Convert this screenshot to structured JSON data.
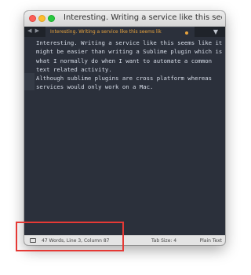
{
  "window": {
    "title": "Interesting. Writing a service like this seems lik"
  },
  "tabbar": {
    "nav_icon": "arrows-left-right",
    "active_tab_label": "Interesting. Writing a service like this seems lik",
    "unsaved_dot_color": "#e8a33d",
    "dropdown_icon": "chevron-down-icon"
  },
  "editor": {
    "paragraphs": [
      "Interesting. Writing a service like this seems like it might be easier than writing a Sublime plugin which is what I normally do when I want to automate a common text related activity.",
      "Although sublime plugins are cross platform whereas services would only work on a Mac."
    ]
  },
  "statusbar": {
    "panel_icon": "panel-icon",
    "position": "47 Words, Line 3, Column 87",
    "tab_size": "Tab Size: 4",
    "syntax": "Plain Text"
  },
  "colors": {
    "editor_bg": "#2b303b",
    "text": "#d8dee9",
    "tab_accent": "#e8a33d",
    "highlight_box": "#e53935"
  }
}
